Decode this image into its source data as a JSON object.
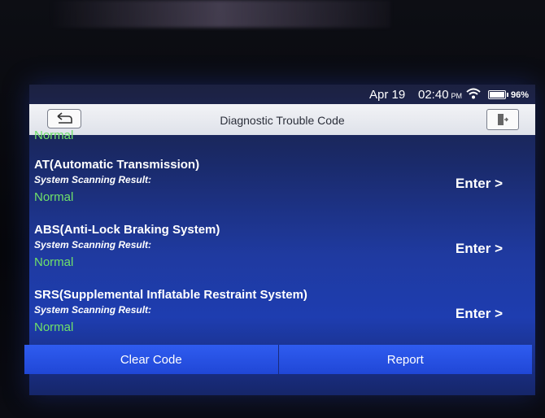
{
  "status": {
    "date": "Apr 19",
    "time": "02:40",
    "ampm": "PM",
    "battery": "96%"
  },
  "header": {
    "title": "Diagnostic Trouble Code"
  },
  "partial_row": {
    "status": "Normal"
  },
  "systems": [
    {
      "name": "AT(Automatic Transmission)",
      "subtitle": "System Scanning Result:",
      "status": "Normal",
      "action": "Enter >"
    },
    {
      "name": "ABS(Anti-Lock Braking System)",
      "subtitle": "System Scanning Result:",
      "status": "Normal",
      "action": "Enter >"
    },
    {
      "name": "SRS(Supplemental Inflatable Restraint System)",
      "subtitle": "System Scanning Result:",
      "status": "Normal",
      "action": "Enter >"
    }
  ],
  "footer": {
    "clear_label": "Clear Code",
    "report_label": "Report"
  },
  "colors": {
    "normal_green": "#6fe06a",
    "button_blue": "#2f5cf0"
  }
}
